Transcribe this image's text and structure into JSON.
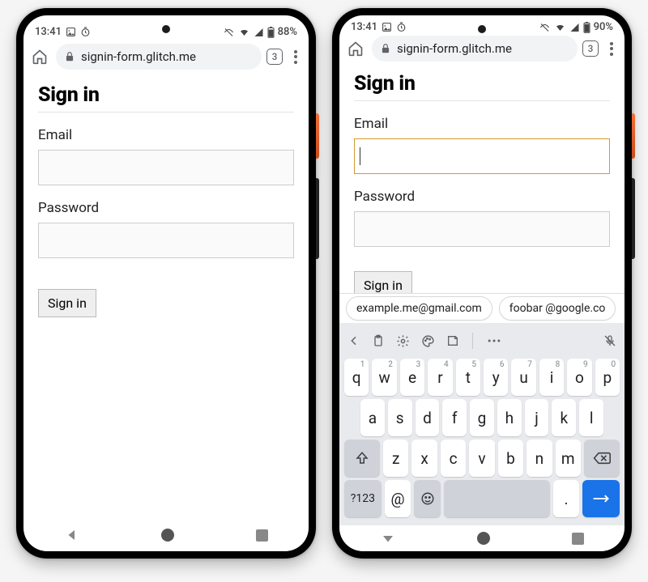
{
  "phoneA": {
    "status": {
      "time": "13:41",
      "battery": "88%"
    },
    "url": {
      "host": "signin-form.glitch.me",
      "tab_count": "3"
    },
    "page": {
      "heading": "Sign in",
      "email_label": "Email",
      "email_value": "",
      "password_label": "Password",
      "password_value": "",
      "submit_label": "Sign in"
    }
  },
  "phoneB": {
    "status": {
      "time": "13:41",
      "battery": "90%"
    },
    "url": {
      "host": "signin-form.glitch.me",
      "tab_count": "3"
    },
    "page": {
      "heading": "Sign in",
      "email_label": "Email",
      "email_value": "",
      "password_label": "Password",
      "password_value": "",
      "submit_label": "Sign in"
    },
    "suggestions": {
      "a": "example.me@gmail.com",
      "b": "foobar @google.co"
    },
    "keyboard": {
      "row1": {
        "k0": "q",
        "k1": "w",
        "k2": "e",
        "k3": "r",
        "k4": "t",
        "k5": "y",
        "k6": "u",
        "k7": "i",
        "k8": "o",
        "k9": "p"
      },
      "sup1": {
        "k0": "1",
        "k1": "2",
        "k2": "3",
        "k3": "4",
        "k4": "5",
        "k5": "6",
        "k6": "7",
        "k7": "8",
        "k8": "9",
        "k9": "0"
      },
      "row2": {
        "k0": "a",
        "k1": "s",
        "k2": "d",
        "k3": "f",
        "k4": "g",
        "k5": "h",
        "k6": "j",
        "k7": "k",
        "k8": "l"
      },
      "row3": {
        "k0": "z",
        "k1": "x",
        "k2": "c",
        "k3": "v",
        "k4": "b",
        "k5": "n",
        "k6": "m"
      },
      "alt": "?123",
      "at": "@",
      "period": "."
    }
  }
}
